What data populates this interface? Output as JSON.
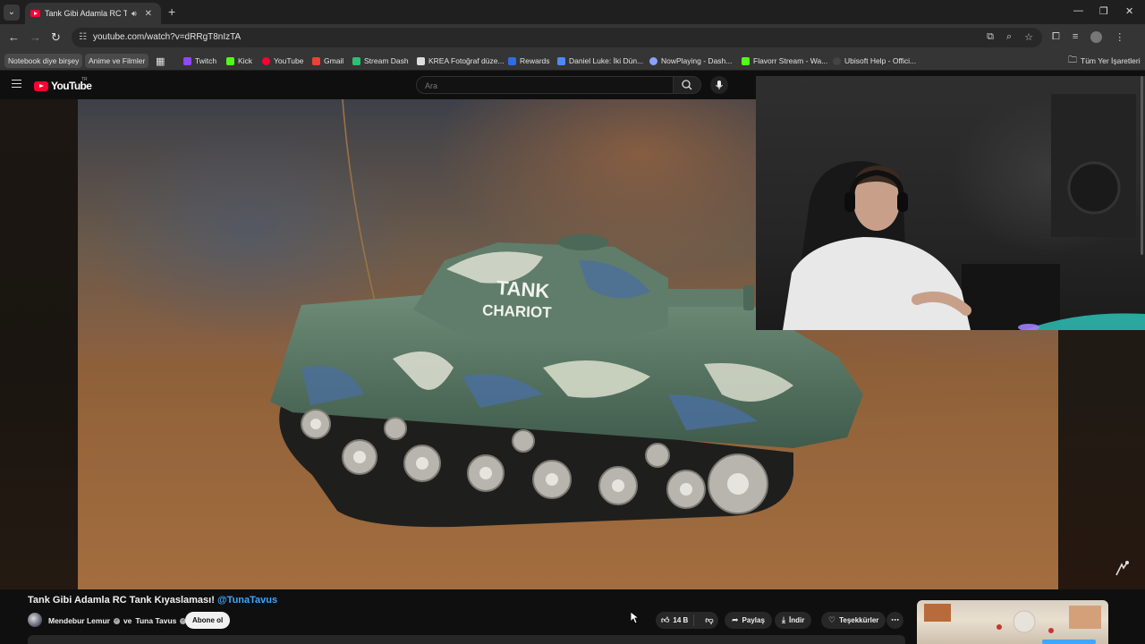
{
  "browser": {
    "tab_title": "Tank Gibi Adamla RC Tank Kıyaslaması!",
    "url": "youtube.com/watch?v=dRRgT8nIzTA",
    "bookmarks": [
      {
        "label": "Notebook diye birşey",
        "chip": true
      },
      {
        "label": "Anime ve Filmler",
        "chip": true
      },
      {
        "label": "Twitch",
        "color": "#9146ff"
      },
      {
        "label": "Kick",
        "color": "#53fc18"
      },
      {
        "label": "YouTube",
        "color": "#ff0033"
      },
      {
        "label": "Gmail",
        "color": "#ea4335"
      },
      {
        "label": "Stream Dash",
        "color": "#2fbf71"
      },
      {
        "label": "KREA Fotoğraf düze...",
        "color": "#dddddd"
      },
      {
        "label": "Rewards",
        "color": "#2b6de8"
      },
      {
        "label": "Daniel Luke: İki Dün...",
        "color": "#4c8bf5"
      },
      {
        "label": "NowPlaying - Dash...",
        "color": "#8aa2ff"
      },
      {
        "label": "Flavorr Stream - Wa...",
        "color": "#53fc18"
      },
      {
        "label": "Ubisoft Help - Offici...",
        "color": "#444444"
      }
    ],
    "all_bookmarks_label": "Tüm Yer İşaretleri"
  },
  "youtube": {
    "logo_text": "YouTube",
    "region": "TR",
    "search_placeholder": "Ara",
    "video": {
      "title": "Tank Gibi Adamla RC Tank Kıyaslaması!",
      "mention": "@TunaTavus",
      "channel_1": "Mendebur Lemur",
      "channel_join": "ve",
      "channel_2": "Tuna Tavus",
      "subscribe_label": "Abone ol",
      "likes": "14 B",
      "share_label": "Paylaş",
      "download_label": "İndir",
      "thanks_label": "Teşekkürler",
      "tank_text_1": "TANK",
      "tank_text_2": "CHARIOT"
    }
  },
  "colors": {
    "accent_red": "#ff0033",
    "link_blue": "#3ea6ff"
  }
}
